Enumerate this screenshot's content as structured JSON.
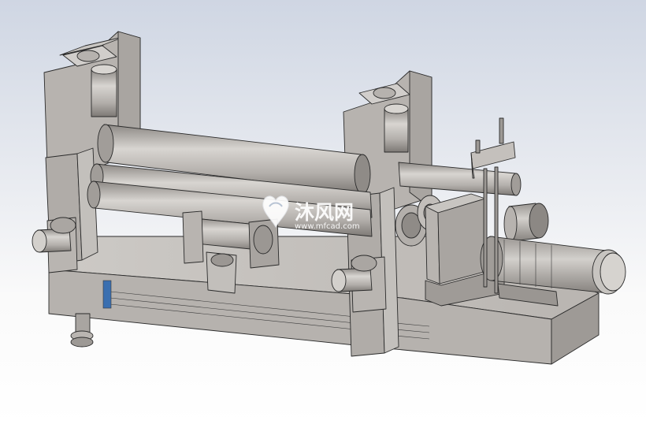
{
  "watermark": {
    "title": "沐风网",
    "url": "www.mfcad.com"
  },
  "colors": {
    "background_top": "#cfd6e3",
    "background_bottom": "#ffffff",
    "metal_light": "#c9c6c2",
    "metal_mid": "#a8a4a0",
    "metal_dark": "#7f7b77",
    "accent_blue": "#3a6fb0"
  }
}
